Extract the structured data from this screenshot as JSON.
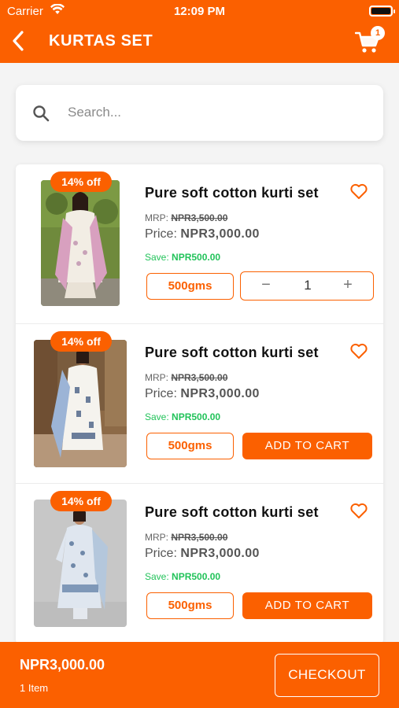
{
  "status_bar": {
    "carrier": "Carrier",
    "time": "12:09 PM"
  },
  "header": {
    "title": "KURTAS SET",
    "cart_count": "1"
  },
  "search": {
    "placeholder": "Search..."
  },
  "products": [
    {
      "discount": "14% off",
      "name": "Pure soft cotton kurti set",
      "mrp_label": "MRP:",
      "mrp": "NPR3,500.00",
      "price_label": "Price:",
      "price": "NPR3,000.00",
      "save_label": "Save:",
      "save": "NPR500.00",
      "weight": "500gms",
      "in_cart": true,
      "quantity": "1",
      "minus_symbol": "−",
      "plus_symbol": "+"
    },
    {
      "discount": "14% off",
      "name": "Pure soft cotton kurti set",
      "mrp_label": "MRP:",
      "mrp": "NPR3,500.00",
      "price_label": "Price:",
      "price": "NPR3,000.00",
      "save_label": "Save:",
      "save": "NPR500.00",
      "weight": "500gms",
      "in_cart": false,
      "add_label": "ADD TO CART"
    },
    {
      "discount": "14% off",
      "name": "Pure soft cotton kurti set",
      "mrp_label": "MRP:",
      "mrp": "NPR3,500.00",
      "price_label": "Price:",
      "price": "NPR3,000.00",
      "save_label": "Save:",
      "save": "NPR500.00",
      "weight": "500gms",
      "in_cart": false,
      "add_label": "ADD TO CART"
    }
  ],
  "footer": {
    "total": "NPR3,000.00",
    "items": "1 Item",
    "checkout_label": "CHECKOUT"
  },
  "colors": {
    "accent": "#fb6000",
    "save_green": "#22c35a"
  },
  "icons": [
    "back-arrow-icon",
    "cart-icon",
    "wifi-icon",
    "battery-icon",
    "search-icon",
    "heart-icon"
  ]
}
